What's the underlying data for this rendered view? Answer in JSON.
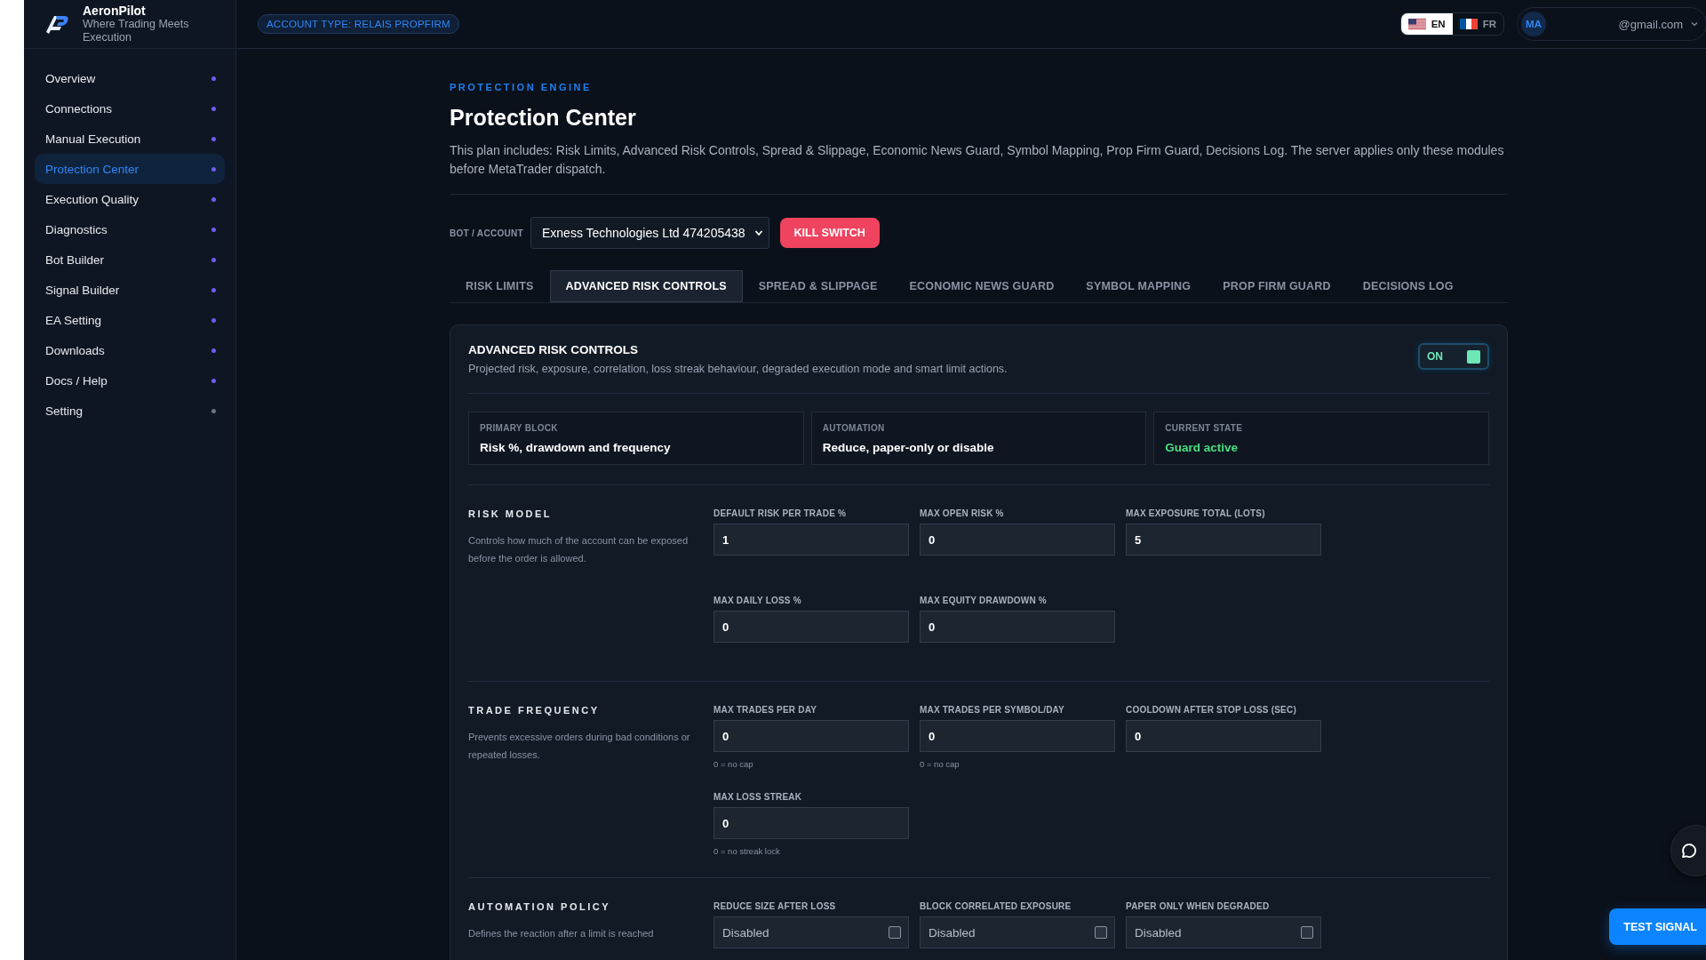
{
  "brand": {
    "name": "AeronPilot",
    "tagline": "Where Trading Meets Execution"
  },
  "sidebar": {
    "items": [
      {
        "label": "Overview",
        "selected": false,
        "color": "#6d5cf0"
      },
      {
        "label": "Connections",
        "selected": false,
        "color": "#6d5cf0"
      },
      {
        "label": "Manual Execution",
        "selected": false,
        "color": "#6d5cf0"
      },
      {
        "label": "Protection Center",
        "selected": true,
        "color": "#6d5cf0"
      },
      {
        "label": "Execution Quality",
        "selected": false,
        "color": "#6d5cf0"
      },
      {
        "label": "Diagnostics",
        "selected": false,
        "color": "#6d5cf0"
      },
      {
        "label": "Bot Builder",
        "selected": false,
        "color": "#6d5cf0"
      },
      {
        "label": "Signal Builder",
        "selected": false,
        "color": "#6d5cf0"
      },
      {
        "label": "EA Setting",
        "selected": false,
        "color": "#6d5cf0"
      },
      {
        "label": "Downloads",
        "selected": false,
        "color": "#6d5cf0"
      },
      {
        "label": "Docs / Help",
        "selected": false,
        "color": "#6d5cf0"
      },
      {
        "label": "Setting",
        "selected": false,
        "color": "#6b7280"
      }
    ]
  },
  "topbar": {
    "account_badge": "ACCOUNT TYPE: RELAIS PROPFIRM",
    "languages": [
      {
        "code": "EN",
        "kind": "us",
        "selected": true
      },
      {
        "code": "FR",
        "kind": "fr",
        "selected": false
      }
    ],
    "user": {
      "initials": "MA",
      "email": "@gmail.com"
    }
  },
  "page": {
    "eyebrow": "PROTECTION ENGINE",
    "title": "Protection Center",
    "description": "This plan includes: Risk Limits, Advanced Risk Controls, Spread & Slippage, Economic News Guard, Symbol Mapping, Prop Firm Guard, Decisions Log. The server applies only these modules before MetaTrader dispatch.",
    "account_label": "BOT / ACCOUNT",
    "account_value": "Exness Technologies Ltd 474205438",
    "kill_switch": "KILL SWITCH"
  },
  "tabs": [
    {
      "label": "RISK LIMITS",
      "selected": false
    },
    {
      "label": "ADVANCED RISK CONTROLS",
      "selected": true
    },
    {
      "label": "SPREAD & SLIPPAGE",
      "selected": false
    },
    {
      "label": "ECONOMIC NEWS GUARD",
      "selected": false
    },
    {
      "label": "SYMBOL MAPPING",
      "selected": false
    },
    {
      "label": "PROP FIRM GUARD",
      "selected": false
    },
    {
      "label": "DECISIONS LOG",
      "selected": false
    }
  ],
  "card": {
    "title": "ADVANCED RISK CONTROLS",
    "subtitle": "Projected risk, exposure, correlation, loss streak behaviour, degraded execution mode and smart limit actions.",
    "toggle": {
      "label": "ON",
      "on": true
    },
    "summary": [
      {
        "label": "PRIMARY BLOCK",
        "value": "Risk %, drawdown and frequency",
        "kind": "plain"
      },
      {
        "label": "AUTOMATION",
        "value": "Reduce, paper-only or disable",
        "kind": "plain"
      },
      {
        "label": "CURRENT STATE",
        "value": "Guard active",
        "kind": "status"
      }
    ],
    "sections": [
      {
        "title": "RISK MODEL",
        "description": "Controls how much of the account can be exposed before the order is allowed.",
        "fields": [
          {
            "kind": "number",
            "label": "DEFAULT RISK PER TRADE %",
            "value": "1"
          },
          {
            "kind": "number",
            "label": "MAX OPEN RISK %",
            "value": "0"
          },
          {
            "kind": "number",
            "label": "MAX EXPOSURE TOTAL (LOTS)",
            "value": "5"
          },
          {
            "kind": "number",
            "label": "MAX DAILY LOSS %",
            "value": "0"
          },
          {
            "kind": "number",
            "label": "MAX EQUITY DRAWDOWN %",
            "value": "0"
          }
        ]
      },
      {
        "title": "TRADE FREQUENCY",
        "description": "Prevents excessive orders during bad conditions or repeated losses.",
        "fields": [
          {
            "kind": "number",
            "label": "MAX TRADES PER DAY",
            "value": "0",
            "hint": "0 = no cap"
          },
          {
            "kind": "number",
            "label": "MAX TRADES PER SYMBOL/DAY",
            "value": "0",
            "hint": "0 = no cap"
          },
          {
            "kind": "number",
            "label": "COOLDOWN AFTER STOP LOSS (SEC)",
            "value": "0"
          },
          {
            "kind": "number",
            "label": "MAX LOSS STREAK",
            "value": "0",
            "hint": "0 = no streak lock"
          }
        ]
      },
      {
        "title": "AUTOMATION POLICY",
        "description": "Defines the reaction after a limit is reached",
        "fields": [
          {
            "kind": "checkbox",
            "label": "REDUCE SIZE AFTER LOSS",
            "value": "Disabled",
            "checked": false
          },
          {
            "kind": "checkbox",
            "label": "BLOCK CORRELATED EXPOSURE",
            "value": "Disabled",
            "checked": false
          },
          {
            "kind": "checkbox",
            "label": "PAPER ONLY WHEN DEGRADED",
            "value": "Disabled",
            "checked": false
          }
        ]
      }
    ]
  },
  "test_signal": "TEST SIGNAL"
}
